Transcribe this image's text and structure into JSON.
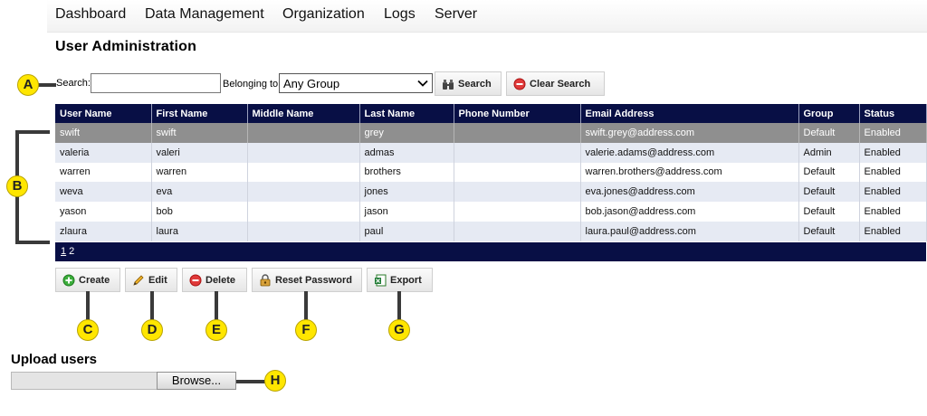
{
  "nav": {
    "items": [
      "Dashboard",
      "Data Management",
      "Organization",
      "Logs",
      "Server"
    ]
  },
  "page": {
    "title": "User Administration"
  },
  "search": {
    "label": "Search:",
    "value": "",
    "belonging_label": "Belonging to",
    "group_selected": "Any Group",
    "search_button": "Search",
    "clear_button": "Clear Search"
  },
  "table": {
    "columns": [
      "User Name",
      "First Name",
      "Middle Name",
      "Last Name",
      "Phone Number",
      "Email Address",
      "Group",
      "Status"
    ],
    "rows": [
      [
        "swift",
        "swift",
        "",
        "grey",
        "",
        "swift.grey@address.com",
        "Default",
        "Enabled"
      ],
      [
        "valeria",
        "valeri",
        "",
        "admas",
        "",
        "valerie.adams@address.com",
        "Admin",
        "Enabled"
      ],
      [
        "warren",
        "warren",
        "",
        "brothers",
        "",
        "warren.brothers@address.com",
        "Default",
        "Enabled"
      ],
      [
        "weva",
        "eva",
        "",
        "jones",
        "",
        "eva.jones@address.com",
        "Default",
        "Enabled"
      ],
      [
        "yason",
        "bob",
        "",
        "jason",
        "",
        "bob.jason@address.com",
        "Default",
        "Enabled"
      ],
      [
        "zlaura",
        "laura",
        "",
        "paul",
        "",
        "laura.paul@address.com",
        "Default",
        "Enabled"
      ]
    ],
    "selected_row": 0,
    "pages": [
      "1",
      "2"
    ],
    "current_page": "1"
  },
  "actions": {
    "create": "Create",
    "edit": "Edit",
    "delete": "Delete",
    "reset_password": "Reset Password",
    "export": "Export"
  },
  "upload": {
    "title": "Upload users",
    "file_value": "",
    "browse": "Browse..."
  },
  "callouts": {
    "a": "A",
    "b": "B",
    "c": "C",
    "d": "D",
    "e": "E",
    "f": "F",
    "g": "G",
    "h": "H"
  },
  "colors": {
    "header_bg": "#080f45",
    "row_alt": "#e6eaf3",
    "row_selected": "#8f8f8f",
    "callout": "#ffe600"
  },
  "icons": {
    "search_button": "binoculars-icon",
    "clear_button": "red-minus-circle-icon",
    "create": "green-plus-circle-icon",
    "edit": "pencil-icon",
    "delete": "red-minus-circle-icon",
    "reset_password": "key-lock-icon",
    "export": "excel-icon"
  }
}
